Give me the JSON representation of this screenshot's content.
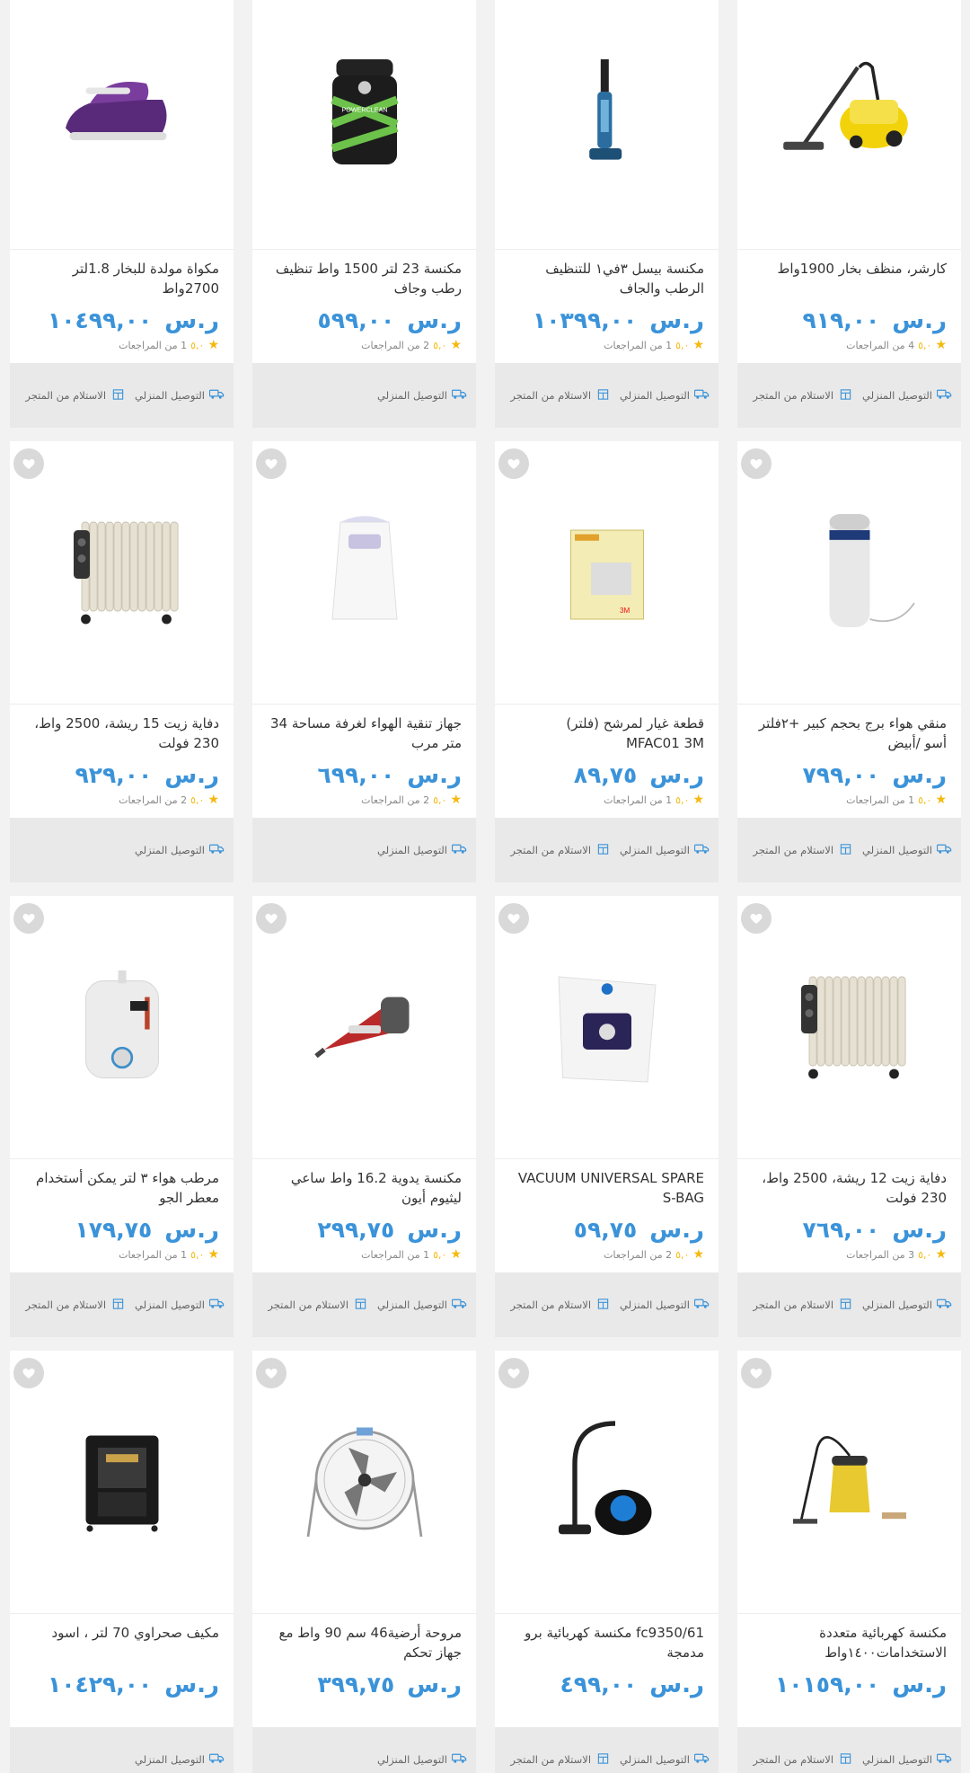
{
  "labels": {
    "delivery": "التوصيل المنزلي",
    "pickup": "الاستلام من المتجر",
    "reviews_suffix": "من المراجعات",
    "currency": "ر.س"
  },
  "products": [
    {
      "title": "كارشر، منظف بخار 1900واط",
      "price": "٩١٩,٠٠",
      "score": "٥,٠",
      "reviews": "4",
      "delivery": true,
      "pickup": true,
      "wishlist": false,
      "image": "steam-cleaner"
    },
    {
      "title": "مكنسة بيسل ٣في١ للتنظيف الرطب والجاف",
      "price": "١٠٣٩٩,٠٠",
      "score": "٥,٠",
      "reviews": "1",
      "delivery": true,
      "pickup": true,
      "wishlist": false,
      "image": "stick-vacuum"
    },
    {
      "title": "مكنسة 23 لتر 1500 واط تنظيف رطب وجاف",
      "price": "٥٩٩,٠٠",
      "score": "٥,٠",
      "reviews": "2",
      "delivery": true,
      "pickup": false,
      "wishlist": false,
      "image": "drum-vacuum"
    },
    {
      "title": "مكواة مولدة للبخار 1.8لتر 2700واط",
      "price": "١٠٤٩٩,٠٠",
      "score": "٥,٠",
      "reviews": "1",
      "delivery": true,
      "pickup": true,
      "wishlist": false,
      "image": "steam-iron"
    },
    {
      "title": "منقي هواء برج بحجم كبير +٢فلتر أسو /أبيض",
      "price": "٧٩٩,٠٠",
      "score": "٥,٠",
      "reviews": "1",
      "delivery": true,
      "pickup": true,
      "wishlist": true,
      "image": "tower-purifier"
    },
    {
      "title": "قطعة غيار لمرشح (فلتر) MFAC01 3M",
      "price": "٨٩,٧٥",
      "score": "٥,٠",
      "reviews": "1",
      "delivery": true,
      "pickup": true,
      "wishlist": true,
      "image": "filter-box"
    },
    {
      "title": "جهاز تنقية الهواء لغرفة مساحة 34 متر مرب",
      "price": "٦٩٩,٠٠",
      "score": "٥,٠",
      "reviews": "2",
      "delivery": true,
      "pickup": false,
      "wishlist": true,
      "image": "room-purifier"
    },
    {
      "title": "دفاية زيت 15 ريشة، 2500 واط، 230 فولت",
      "price": "٩٢٩,٠٠",
      "score": "٥,٠",
      "reviews": "2",
      "delivery": true,
      "pickup": false,
      "wishlist": true,
      "image": "oil-heater"
    },
    {
      "title": "دفاية زيت 12 ريشة، 2500 واط، 230 فولت",
      "price": "٧٦٩,٠٠",
      "score": "٥,٠",
      "reviews": "3",
      "delivery": true,
      "pickup": true,
      "wishlist": true,
      "image": "oil-heater"
    },
    {
      "title": "VACUUM UNIVERSAL SPARE S-BAG",
      "price": "٥٩,٧٥",
      "score": "٥,٠",
      "reviews": "2",
      "delivery": true,
      "pickup": true,
      "wishlist": true,
      "image": "vacuum-bag"
    },
    {
      "title": "مكنسة يدوية 16.2 واط ساعي ليثيوم أيون",
      "price": "٢٩٩,٧٥",
      "score": "٥,٠",
      "reviews": "1",
      "delivery": true,
      "pickup": true,
      "wishlist": true,
      "image": "hand-vacuum"
    },
    {
      "title": "مرطب هواء ٣ لتر يمكن أستخدام معطر الجو",
      "price": "١٧٩,٧٥",
      "score": "٥,٠",
      "reviews": "1",
      "delivery": true,
      "pickup": true,
      "wishlist": true,
      "image": "humidifier"
    },
    {
      "title": "مكنسة كهربائية متعددة الاستخدامات١٤٠٠واط",
      "price": "١٠١٥٩,٠٠",
      "score": "",
      "reviews": "",
      "delivery": true,
      "pickup": true,
      "wishlist": true,
      "image": "wet-dry-vacuum"
    },
    {
      "title": "fc9350/61 مكنسة كهربائية برو مدمجة",
      "price": "٤٩٩,٠٠",
      "score": "",
      "reviews": "",
      "delivery": true,
      "pickup": true,
      "wishlist": true,
      "image": "canister-vacuum"
    },
    {
      "title": "مروحة أرضية46 سم 90 واط مع جهاز تحكم",
      "price": "٣٩٩,٧٥",
      "score": "",
      "reviews": "",
      "delivery": true,
      "pickup": false,
      "wishlist": true,
      "image": "floor-fan"
    },
    {
      "title": "مكيف صحراوي 70 لتر ، اسود",
      "price": "١٠٤٢٩,٠٠",
      "score": "",
      "reviews": "",
      "delivery": true,
      "pickup": false,
      "wishlist": true,
      "image": "air-cooler"
    }
  ]
}
